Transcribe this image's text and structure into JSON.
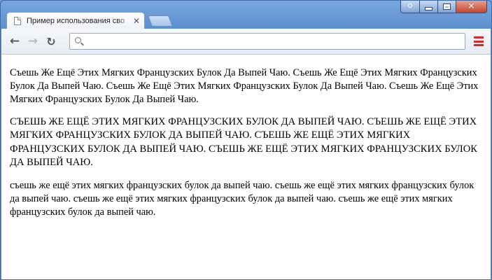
{
  "window": {
    "controls": [
      "profile-icon",
      "minimize-icon",
      "maximize-icon",
      "close-icon"
    ]
  },
  "tabs": [
    {
      "title": "Пример использования сво",
      "icon": "document-icon",
      "active": true
    }
  ],
  "toolbar": {
    "address_value": "",
    "icons": [
      "back-arrow-icon",
      "forward-arrow-icon",
      "reload-icon",
      "search-icon",
      "menu-icon"
    ],
    "menu_color": "#d52b2b"
  },
  "content": {
    "paragraphs": [
      {
        "text": "Съешь Же Ещё Этих Мягких Французских Булок Да Выпей Чаю. Съешь Же Ещё Этих Мягких Французских Булок Да Выпей Чаю. Съешь Же Ещё Этих Мягких Французских Булок Да Выпей Чаю. Съешь Же Ещё Этих Мягких Французских Булок Да Выпей Чаю."
      },
      {
        "text": "СЪЕШЬ ЖЕ ЕЩЁ ЭТИХ МЯГКИХ ФРАНЦУЗСКИХ БУЛОК ДА ВЫПЕЙ ЧАЮ. СЪЕШЬ ЖЕ ЕЩЁ ЭТИХ МЯГКИХ ФРАНЦУЗСКИХ БУЛОК ДА ВЫПЕЙ ЧАЮ. СЪЕШЬ ЖЕ ЕЩЁ ЭТИХ МЯГКИХ ФРАНЦУЗСКИХ БУЛОК ДА ВЫПЕЙ ЧАЮ. СЪЕШЬ ЖЕ ЕЩЁ ЭТИХ МЯГКИХ ФРАНЦУЗСКИХ БУЛОК ДА ВЫПЕЙ ЧАЮ."
      },
      {
        "text": "съешь же ещё этих мягких французских булок да выпей чаю. съешь же ещё этих мягких французских булок да выпей чаю. съешь же ещё этих мягких французских булок да выпей чаю. съешь же ещё этих мягких французских булок да выпей чаю."
      }
    ]
  }
}
